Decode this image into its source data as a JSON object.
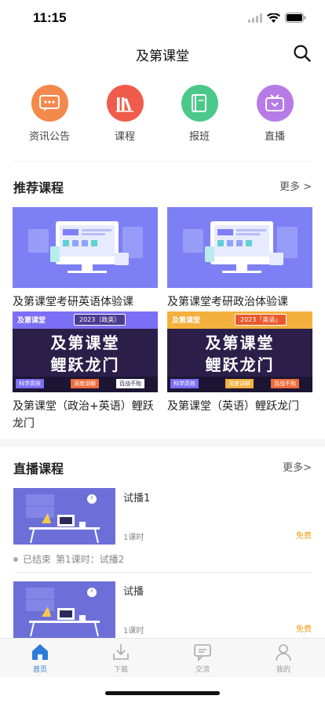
{
  "status": {
    "time": "11:15"
  },
  "nav": {
    "title": "及第课堂"
  },
  "quick_menu": [
    {
      "label": "资讯公告",
      "icon": "chat-bubble-icon",
      "color": "#f4894c"
    },
    {
      "label": "课程",
      "icon": "books-icon",
      "color": "#f05c4b"
    },
    {
      "label": "报班",
      "icon": "notebook-icon",
      "color": "#4cc98a"
    },
    {
      "label": "直播",
      "icon": "tv-icon",
      "color": "#b77be8"
    }
  ],
  "recommended": {
    "title": "推荐课程",
    "more": "更多 >",
    "courses": [
      {
        "title": "及第课堂考研英语体验课"
      },
      {
        "title": "及第课堂考研政治体验课"
      },
      {
        "title": "及第课堂（政治+英语）鲤跃龙门",
        "banner_tag": "2023（政英）",
        "banner_main1": "及第课堂",
        "banner_main2": "鲤跃龙门",
        "b1": "科学高效",
        "b2": "深度讲解",
        "b3": "百战不殆",
        "brand": "及第课堂"
      },
      {
        "title": "及第课堂（英语）鲤跃龙门",
        "banner_tag": "2023「英语」",
        "banner_main1": "及第课堂",
        "banner_main2": "鲤跃龙门",
        "b1": "科学高效",
        "b2": "深度讲解",
        "b3": "百战不殆",
        "brand": "及第课堂"
      }
    ]
  },
  "live": {
    "title": "直播课程",
    "more": "更多>",
    "items": [
      {
        "title": "试播1",
        "hours": "1课时",
        "price": "免费",
        "status": "已结束",
        "lesson": "第1课时：试播2"
      },
      {
        "title": "试播",
        "hours": "1课时",
        "price": "免费"
      }
    ]
  },
  "tabbar": [
    {
      "label": "首页",
      "icon": "home-icon",
      "active": true
    },
    {
      "label": "下载",
      "icon": "download-icon",
      "active": false
    },
    {
      "label": "交流",
      "icon": "message-icon",
      "active": false
    },
    {
      "label": "我的",
      "icon": "user-icon",
      "active": false
    }
  ],
  "colors": {
    "accent": "#2b7bd8",
    "free": "#f39c12",
    "banner_purple": "#7c6ff5",
    "banner_dark": "#2b1f4a"
  }
}
